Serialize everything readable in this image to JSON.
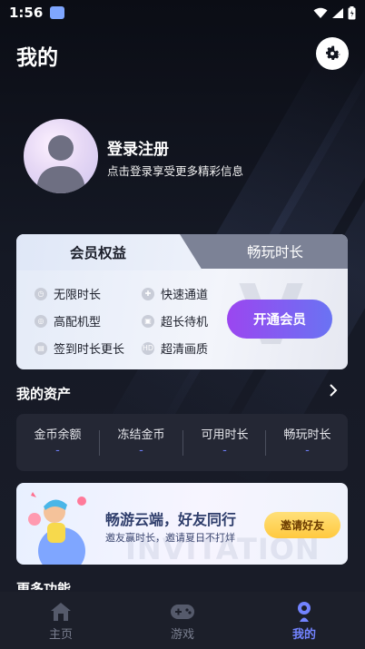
{
  "status_bar": {
    "time": "1:56"
  },
  "header": {
    "title": "我的"
  },
  "profile": {
    "login_title": "登录注册",
    "login_sub": "点击登录享受更多精彩信息"
  },
  "membership": {
    "tabs": [
      "会员权益",
      "畅玩时长"
    ],
    "benefits": [
      "无限时长",
      "快速通道",
      "高配机型",
      "超长待机",
      "签到时长更长",
      "超清画质"
    ],
    "vip_button": "开通会员"
  },
  "assets": {
    "title": "我的资产",
    "items": [
      {
        "label": "金币余额",
        "value": "-"
      },
      {
        "label": "冻结金币",
        "value": "-"
      },
      {
        "label": "可用时长",
        "value": "-"
      },
      {
        "label": "畅玩时长",
        "value": "-"
      }
    ]
  },
  "banner": {
    "title": "畅游云端，好友同行",
    "subtitle": "邀友赢时长，邀请夏日不打烊",
    "watermark": "INVITATION",
    "button": "邀请好友"
  },
  "more": {
    "title": "更多功能"
  },
  "nav": {
    "items": [
      {
        "label": "主页"
      },
      {
        "label": "游戏"
      },
      {
        "label": "我的"
      }
    ]
  },
  "colors": {
    "accent": "#7283ff",
    "vip_start": "#9b46f0",
    "vip_end": "#6a73f3"
  }
}
